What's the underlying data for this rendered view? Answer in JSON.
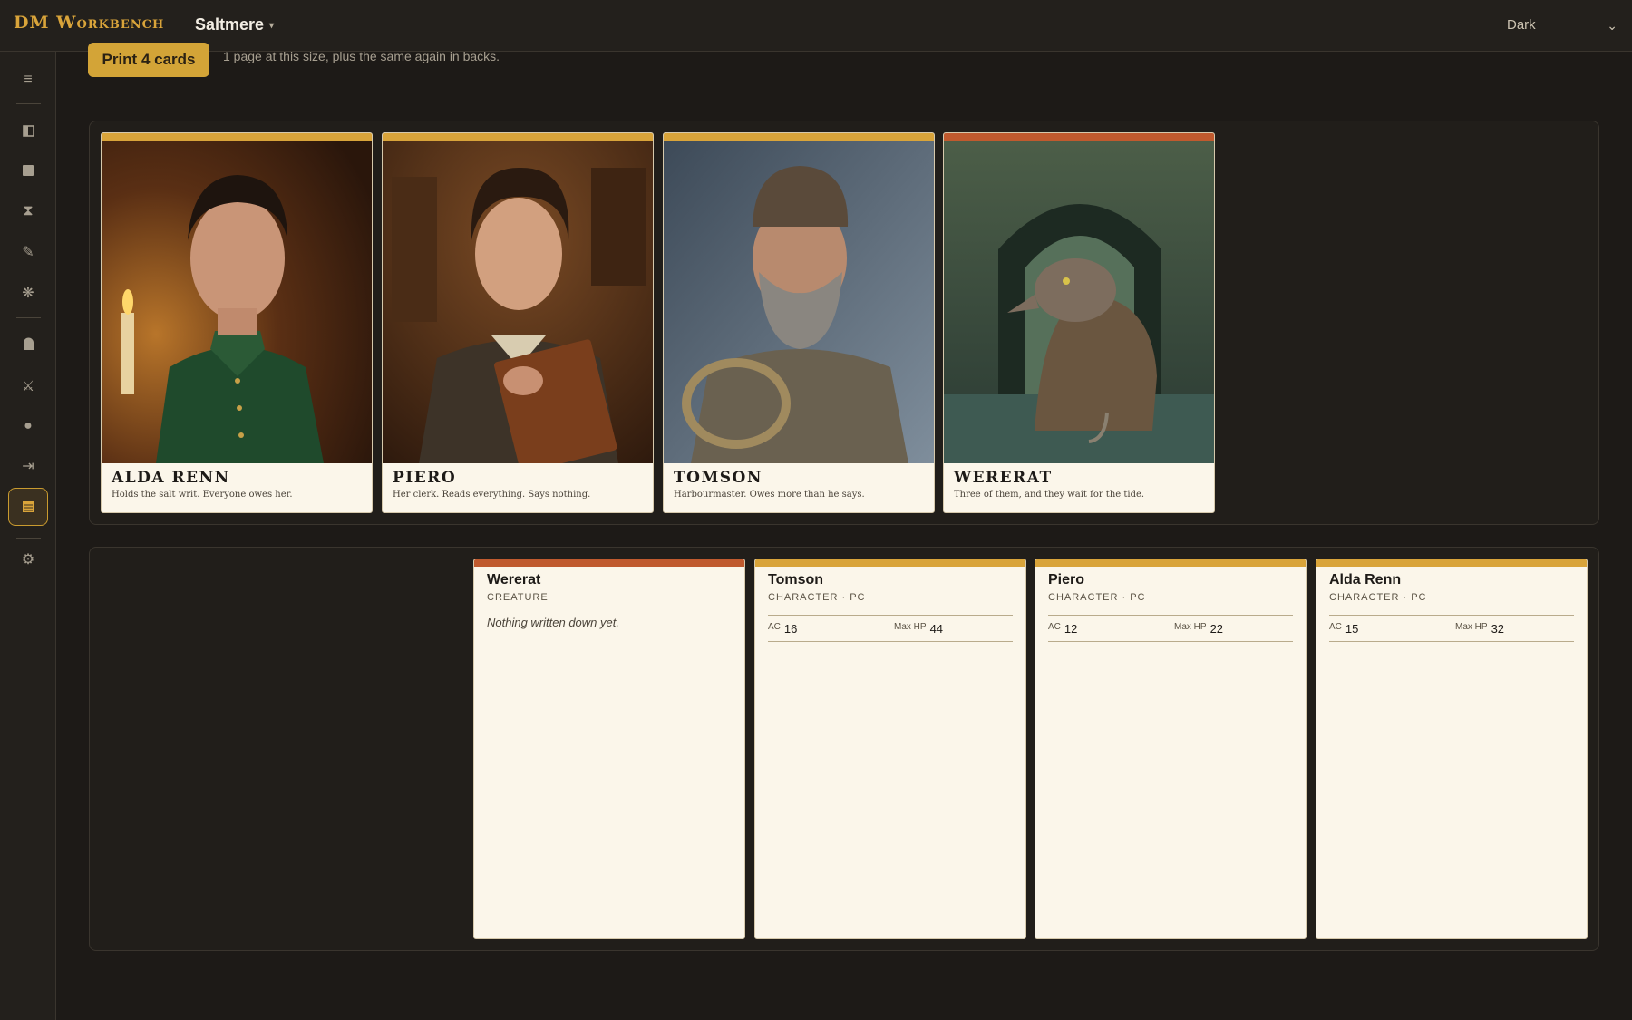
{
  "app": {
    "brand": "DM Workbench",
    "campaign": "Saltmere",
    "theme": "Dark"
  },
  "print": {
    "button_label": "Print 4 cards",
    "note": "1 page at this size, plus the same again in backs."
  },
  "sidebar": {
    "icons": [
      "menu-icon",
      "panel-icon",
      "square-icon",
      "hourglass-icon",
      "pencil-icon",
      "sparkle-icon",
      "tomb-icon",
      "swords-icon",
      "dot-icon",
      "export-icon",
      "cards-icon",
      "settings-icon"
    ]
  },
  "front_cards": [
    {
      "name": "ALDA RENN",
      "tagline": "Holds the salt writ. Everyone owes her.",
      "accent": "#d9a43a",
      "portrait": "woman-green-coat-candle"
    },
    {
      "name": "PIERO",
      "tagline": "Her clerk. Reads everything. Says nothing.",
      "accent": "#d9a43a",
      "portrait": "young-clerk-with-book"
    },
    {
      "name": "TOMSON",
      "tagline": "Harbourmaster. Owes more than he says.",
      "accent": "#d9a43a",
      "portrait": "bearded-sailor-rope"
    },
    {
      "name": "WERERAT",
      "tagline": "Three of them, and they wait for the tide.",
      "accent": "#c05a2e",
      "portrait": "wererat-in-sewer"
    }
  ],
  "back_cards": [
    {
      "name": "Wererat",
      "type": "CREATURE",
      "note": "Nothing written down yet.",
      "accent": "#c05a2e"
    },
    {
      "name": "Tomson",
      "type": "CHARACTER · PC",
      "ac_label": "AC",
      "ac": "16",
      "hp_label": "Max HP",
      "hp": "44",
      "accent": "#d9a43a"
    },
    {
      "name": "Piero",
      "type": "CHARACTER · PC",
      "ac_label": "AC",
      "ac": "12",
      "hp_label": "Max HP",
      "hp": "22",
      "accent": "#d9a43a"
    },
    {
      "name": "Alda Renn",
      "type": "CHARACTER · PC",
      "ac_label": "AC",
      "ac": "15",
      "hp_label": "Max HP",
      "hp": "32",
      "accent": "#d9a43a"
    }
  ]
}
